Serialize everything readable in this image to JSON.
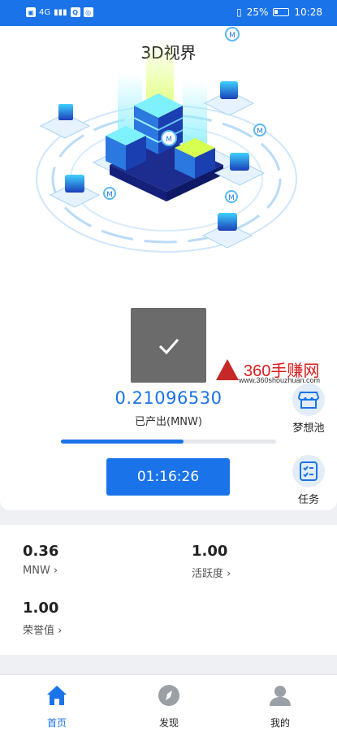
{
  "status_bar": {
    "battery": "25%",
    "time": "10:28",
    "signal_label": "4G"
  },
  "header": {
    "title": "3D视界"
  },
  "watermark": {
    "brand": "360手赚网",
    "url": "www.360shouzhuan.com"
  },
  "mining": {
    "value": "0.21096530",
    "label": "已产出(MNW)",
    "progress": 0.57,
    "timer": "01:16:26"
  },
  "side_buttons": [
    {
      "label": "梦想池",
      "icon": "store-icon"
    },
    {
      "label": "任务",
      "icon": "task-list-icon"
    }
  ],
  "stats": [
    {
      "value": "0.36",
      "label": "MNW ›"
    },
    {
      "value": "1.00",
      "label": "活跃度 ›"
    },
    {
      "value": "1.00",
      "label": "荣誉值 ›"
    }
  ],
  "nav": [
    {
      "label": "首页",
      "icon": "home-icon",
      "active": true
    },
    {
      "label": "发现",
      "icon": "compass-icon",
      "active": false
    },
    {
      "label": "我的",
      "icon": "user-icon",
      "active": false
    }
  ],
  "colors": {
    "accent": "#1a73e8",
    "check_overlay": "#606060"
  }
}
